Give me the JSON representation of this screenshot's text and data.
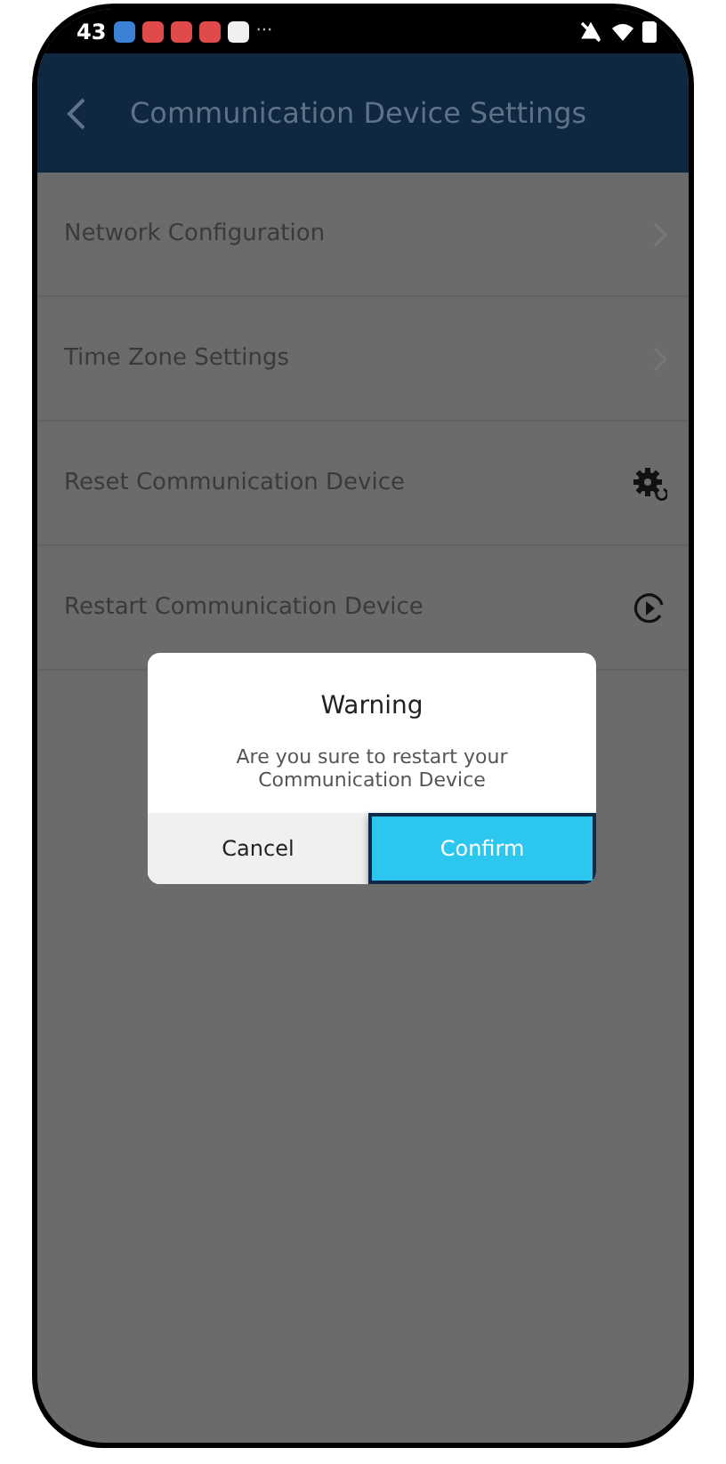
{
  "status_bar": {
    "time": "43",
    "notifications": [
      {
        "color": "#3b82d6"
      },
      {
        "color": "#e04a4a"
      },
      {
        "color": "#e04a4a"
      },
      {
        "color": "#e04a4a"
      },
      {
        "color": "#f0f0f0"
      }
    ],
    "more": "···"
  },
  "header": {
    "title": "Communication Device Settings"
  },
  "items": [
    {
      "label": "Network Configuration",
      "kind": "chevron"
    },
    {
      "label": "Time Zone Settings",
      "kind": "chevron"
    },
    {
      "label": "Reset Communication Device",
      "kind": "gear"
    },
    {
      "label": "Restart Communication Device",
      "kind": "play"
    }
  ],
  "dialog": {
    "title": "Warning",
    "message": "Are you sure to restart your Communication Device",
    "buttons": [
      {
        "label": "Cancel",
        "selected": false
      },
      {
        "label": "Confirm",
        "selected": true
      }
    ]
  }
}
